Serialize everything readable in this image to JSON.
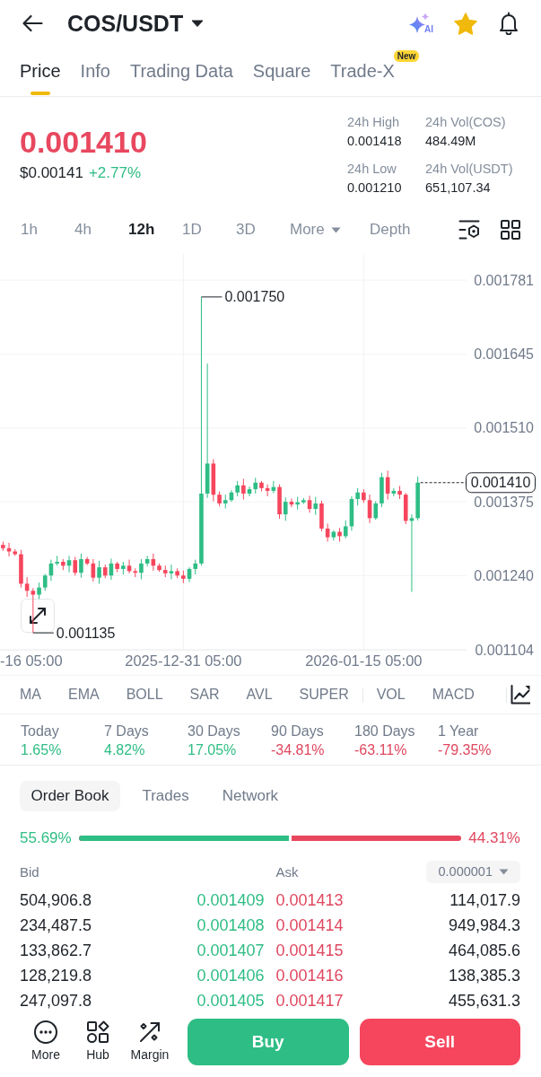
{
  "header": {
    "title": "COS/USDT",
    "ai_label": "AI"
  },
  "tabs": [
    {
      "label": "Price",
      "selected": true
    },
    {
      "label": "Info",
      "selected": false
    },
    {
      "label": "Trading Data",
      "selected": false
    },
    {
      "label": "Square",
      "selected": false
    },
    {
      "label": "Trade-X",
      "selected": false,
      "badge": "New"
    }
  ],
  "price": {
    "last": "0.001410",
    "usd": "$0.00141",
    "change": "+2.77%",
    "stats": [
      {
        "label": "24h High",
        "value": "0.001418"
      },
      {
        "label": "24h Vol(COS)",
        "value": "484.49M"
      },
      {
        "label": "24h Low",
        "value": "0.001210"
      },
      {
        "label": "24h Vol(USDT)",
        "value": "651,107.34"
      }
    ]
  },
  "intervals": [
    {
      "label": "1h",
      "kind": "interval",
      "selected": false
    },
    {
      "label": "4h",
      "kind": "interval",
      "selected": false
    },
    {
      "label": "12h",
      "kind": "interval",
      "selected": true
    },
    {
      "label": "1D",
      "kind": "interval",
      "selected": false
    },
    {
      "label": "3D",
      "kind": "interval",
      "selected": false
    },
    {
      "label": "More",
      "kind": "menu",
      "selected": false
    },
    {
      "label": "Depth",
      "kind": "view",
      "selected": false
    }
  ],
  "chart": {
    "chart_data": {
      "type": "candlestick",
      "categories": [
        null,
        null,
        null,
        null,
        null,
        null,
        null,
        null,
        null,
        null,
        null,
        null,
        null,
        null,
        null,
        null,
        null,
        null,
        null,
        null,
        null,
        null,
        null,
        null,
        null,
        null,
        null,
        null,
        null,
        null,
        "2025-12-31 05:00",
        null,
        null,
        null,
        null,
        null,
        null,
        null,
        null,
        null,
        null,
        null,
        null,
        null,
        null,
        null,
        null,
        null,
        null,
        null,
        null,
        null,
        null,
        null,
        null,
        null,
        null,
        null,
        null,
        null,
        "2026-01-15 05:00",
        null,
        null,
        null,
        null,
        null,
        null,
        null,
        null,
        null
      ],
      "ohlc": [
        [
          0.001296,
          0.001302,
          0.001285,
          0.00129
        ],
        [
          0.00129,
          0.0013,
          0.001275,
          0.001284
        ],
        [
          0.001284,
          0.001288,
          0.001276,
          0.001279
        ],
        [
          0.001279,
          0.001287,
          0.001218,
          0.001225
        ],
        [
          0.001225,
          0.001237,
          0.001201,
          0.001212
        ],
        [
          0.001212,
          0.001217,
          0.001135,
          0.001205
        ],
        [
          0.001205,
          0.001227,
          0.001197,
          0.001218
        ],
        [
          0.001218,
          0.001243,
          0.001212,
          0.00124
        ],
        [
          0.00124,
          0.001269,
          0.00123,
          0.001262
        ],
        [
          0.001262,
          0.001276,
          0.001258,
          0.001265
        ],
        [
          0.001265,
          0.00127,
          0.00125,
          0.001258
        ],
        [
          0.001258,
          0.001276,
          0.001246,
          0.001268
        ],
        [
          0.001268,
          0.001274,
          0.00124,
          0.001245
        ],
        [
          0.001245,
          0.00128,
          0.001236,
          0.00127
        ],
        [
          0.00127,
          0.001274,
          0.001259,
          0.001262
        ],
        [
          0.001262,
          0.00127,
          0.001229,
          0.001236
        ],
        [
          0.001236,
          0.001267,
          0.001225,
          0.001255
        ],
        [
          0.001255,
          0.00126,
          0.001235,
          0.00124
        ],
        [
          0.00124,
          0.001271,
          0.001232,
          0.001262
        ],
        [
          0.001262,
          0.001265,
          0.001246,
          0.001252
        ],
        [
          0.001252,
          0.001265,
          0.001242,
          0.001258
        ],
        [
          0.001258,
          0.001269,
          0.001244,
          0.001248
        ],
        [
          0.001248,
          0.001253,
          0.001237,
          0.001245
        ],
        [
          0.001245,
          0.00127,
          0.001233,
          0.001262
        ],
        [
          0.001262,
          0.001276,
          0.001257,
          0.00127
        ],
        [
          0.00127,
          0.00128,
          0.001249,
          0.001258
        ],
        [
          0.001258,
          0.001262,
          0.001247,
          0.00125
        ],
        [
          0.00125,
          0.001258,
          0.001237,
          0.001244
        ],
        [
          0.001244,
          0.00126,
          0.001233,
          0.001248
        ],
        [
          0.001248,
          0.001253,
          0.001235,
          0.00124
        ],
        [
          0.00124,
          0.001249,
          0.001226,
          0.001234
        ],
        [
          0.001234,
          0.001255,
          0.001228,
          0.001252
        ],
        [
          0.001252,
          0.001269,
          0.001242,
          0.001262
        ],
        [
          0.001262,
          0.00175,
          0.001258,
          0.00139
        ],
        [
          0.00139,
          0.001628,
          0.001382,
          0.001445
        ],
        [
          0.001445,
          0.001453,
          0.001376,
          0.001388
        ],
        [
          0.001388,
          0.001394,
          0.001367,
          0.001372
        ],
        [
          0.001372,
          0.001388,
          0.001363,
          0.001378
        ],
        [
          0.001378,
          0.001396,
          0.001375,
          0.001392
        ],
        [
          0.001392,
          0.001413,
          0.001385,
          0.001405
        ],
        [
          0.001405,
          0.001417,
          0.001379,
          0.00139
        ],
        [
          0.00139,
          0.001403,
          0.001385,
          0.001398
        ],
        [
          0.001398,
          0.001419,
          0.00139,
          0.00141
        ],
        [
          0.00141,
          0.001413,
          0.001394,
          0.0014
        ],
        [
          0.0014,
          0.001407,
          0.001385,
          0.001395
        ],
        [
          0.001395,
          0.001413,
          0.001391,
          0.001402
        ],
        [
          0.001402,
          0.001407,
          0.001344,
          0.001352
        ],
        [
          0.001352,
          0.001383,
          0.00134,
          0.001375
        ],
        [
          0.001375,
          0.001381,
          0.001365,
          0.00137
        ],
        [
          0.00137,
          0.001384,
          0.001361,
          0.001374
        ],
        [
          0.001374,
          0.001382,
          0.001371,
          0.001378
        ],
        [
          0.001378,
          0.001386,
          0.001355,
          0.001362
        ],
        [
          0.001362,
          0.001384,
          0.001351,
          0.001372
        ],
        [
          0.001372,
          0.001377,
          0.001321,
          0.001326
        ],
        [
          0.001326,
          0.001335,
          0.001302,
          0.00131
        ],
        [
          0.00131,
          0.001323,
          0.001304,
          0.00132
        ],
        [
          0.00132,
          0.001327,
          0.001302,
          0.001312
        ],
        [
          0.001312,
          0.001341,
          0.001308,
          0.00133
        ],
        [
          0.00133,
          0.001385,
          0.001322,
          0.00138
        ],
        [
          0.00138,
          0.0014,
          0.001368,
          0.001392
        ],
        [
          0.001392,
          0.001398,
          0.001373,
          0.001378
        ],
        [
          0.001378,
          0.001388,
          0.001336,
          0.001345
        ],
        [
          0.001345,
          0.001376,
          0.001342,
          0.001372
        ],
        [
          0.001372,
          0.001428,
          0.001365,
          0.00142
        ],
        [
          0.00142,
          0.001432,
          0.001379,
          0.00139
        ],
        [
          0.00139,
          0.0014,
          0.001385,
          0.001395
        ],
        [
          0.001395,
          0.001404,
          0.00138,
          0.001388
        ],
        [
          0.001388,
          0.001391,
          0.001334,
          0.00134
        ],
        [
          0.00134,
          0.001352,
          0.00121,
          0.001345
        ],
        [
          0.001345,
          0.001421,
          0.001341,
          0.00141
        ]
      ],
      "ylim": [
        0.001104,
        0.001781
      ],
      "yticks": [
        {
          "value": 0.001781,
          "label": "0.001781"
        },
        {
          "value": 0.001645,
          "label": "0.001645"
        },
        {
          "value": 0.00151,
          "label": "0.001510"
        },
        {
          "value": 0.001375,
          "label": "0.001375"
        },
        {
          "value": 0.00124,
          "label": "0.001240"
        },
        {
          "value": 0.001104,
          "label": "0.001104"
        }
      ],
      "grid": true,
      "annotations": [
        "0.001750",
        "0.001135"
      ]
    },
    "cut_axis_label": "-16 05:00",
    "last_price_tag": "0.001410"
  },
  "indicators": {
    "main": [
      "MA",
      "EMA",
      "BOLL",
      "SAR",
      "AVL",
      "SUPER"
    ],
    "sub": [
      "VOL",
      "MACD"
    ]
  },
  "performance": [
    {
      "label": "Today",
      "value": "1.65%",
      "color": "#2ebd85"
    },
    {
      "label": "7 Days",
      "value": "4.82%",
      "color": "#2ebd85"
    },
    {
      "label": "30 Days",
      "value": "17.05%",
      "color": "#2ebd85"
    },
    {
      "label": "90 Days",
      "value": "-34.81%",
      "color": "#e0475f"
    },
    {
      "label": "180 Days",
      "value": "-63.11%",
      "color": "#e0475f"
    },
    {
      "label": "1 Year",
      "value": "-79.35%",
      "color": "#e0475f"
    }
  ],
  "order_book": {
    "tabs": [
      {
        "label": "Order Book",
        "selected": true
      },
      {
        "label": "Trades",
        "selected": false
      },
      {
        "label": "Network",
        "selected": false
      }
    ],
    "ratio": {
      "level": 0.5569,
      "bid_share": "55.69%",
      "ask_share": "44.31%"
    },
    "columns": {
      "bid": "Bid",
      "ask": "Ask"
    },
    "precision": "0.000001",
    "rows": [
      {
        "bid_amount": "504,906.8",
        "bid_price": "0.001409",
        "ask_price": "0.001413",
        "ask_amount": "114,017.9"
      },
      {
        "bid_amount": "234,487.5",
        "bid_price": "0.001408",
        "ask_price": "0.001414",
        "ask_amount": "949,984.3"
      },
      {
        "bid_amount": "133,862.7",
        "bid_price": "0.001407",
        "ask_price": "0.001415",
        "ask_amount": "464,085.6"
      },
      {
        "bid_amount": "128,219.8",
        "bid_price": "0.001406",
        "ask_price": "0.001416",
        "ask_amount": "138,385.3"
      },
      {
        "bid_amount": "247,097.8",
        "bid_price": "0.001405",
        "ask_price": "0.001417",
        "ask_amount": "455,631.3"
      }
    ]
  },
  "action_bar": {
    "items": [
      "More",
      "Hub",
      "Margin"
    ],
    "buy": "Buy",
    "sell": "Sell"
  }
}
